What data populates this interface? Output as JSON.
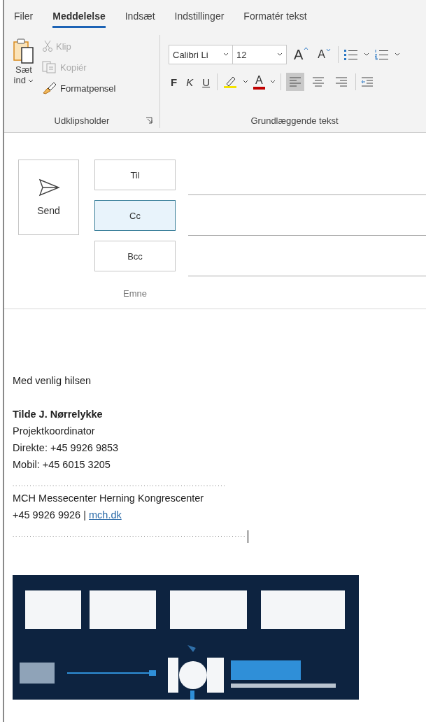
{
  "tabs": [
    {
      "label": "Filer",
      "selected": false
    },
    {
      "label": "Meddelelse",
      "selected": true
    },
    {
      "label": "Indsæt",
      "selected": false
    },
    {
      "label": "Indstillinger",
      "selected": false
    },
    {
      "label": "Formatér tekst",
      "selected": false
    }
  ],
  "clipboard": {
    "paste_lines": [
      "Sæt",
      "ind"
    ],
    "commands": [
      {
        "label": "Klip",
        "kind": "cut",
        "disabled": true
      },
      {
        "label": "Kopiér",
        "kind": "copy",
        "disabled": true
      },
      {
        "label": "Formatpensel",
        "kind": "painter",
        "disabled": false
      }
    ],
    "group_label": "Udklipsholder"
  },
  "basic_text": {
    "font": "Calibri Li",
    "size": "12",
    "grow": "A",
    "shrink": "A",
    "bold": "F",
    "italic": "K",
    "underline": "U",
    "font_color": "A",
    "align": [
      {
        "kind": "left",
        "selected": true
      },
      {
        "kind": "center",
        "selected": false
      },
      {
        "kind": "right",
        "selected": false
      }
    ],
    "group_label": "Grundlæggende tekst"
  },
  "compose": {
    "send": "Send",
    "recipients": [
      {
        "label": "Til",
        "focused": false
      },
      {
        "label": "Cc",
        "focused": true
      },
      {
        "label": "Bcc",
        "focused": false
      }
    ],
    "subject_label": "Emne"
  },
  "body": [
    {
      "kind": "text",
      "text": "Med venlig hilsen"
    },
    {
      "kind": "blank"
    },
    {
      "kind": "bold",
      "text": "Tilde J. Nørrelykke"
    },
    {
      "kind": "text",
      "text": "Projektkoordinator"
    },
    {
      "kind": "text",
      "text": "Direkte:  +45 9926 9853"
    },
    {
      "kind": "text",
      "text": "Mobil: +45 6015 3205"
    },
    {
      "kind": "dots",
      "text": "..........................................................................."
    },
    {
      "kind": "text",
      "text": "MCH Messecenter Herning Kongrescenter"
    },
    {
      "kind": "link",
      "text": "+45 9926 9926 | ",
      "link": "mch.dk"
    },
    {
      "kind": "dots",
      "text": "..................................................................................",
      "cursor": true
    }
  ]
}
